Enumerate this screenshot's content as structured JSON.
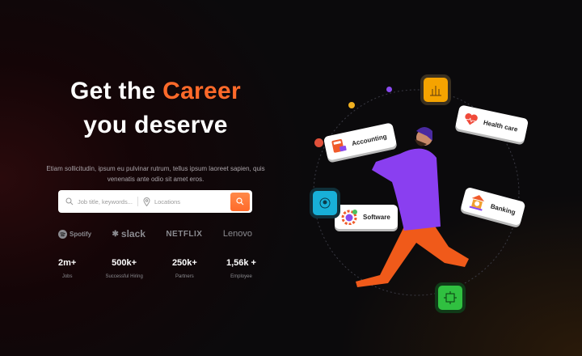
{
  "hero": {
    "title_pre": "Get the ",
    "title_accent": "Career",
    "title_line2": "you deserve",
    "description": "Etiam sollicitudin, ipsum eu pulvinar rutrum, tellus ipsum laoreet sapien, quis venenatis ante odio sit amet eros."
  },
  "search": {
    "job_placeholder": "Job title, keywords...",
    "location_placeholder": "Locations",
    "button_icon": "search-icon"
  },
  "logos": [
    "Spotify",
    "slack",
    "NETFLIX",
    "Lenovo"
  ],
  "stats": [
    {
      "value": "2m+",
      "label": "Jobs"
    },
    {
      "value": "500k+",
      "label": "Successful Hiring"
    },
    {
      "value": "250k+",
      "label": "Partners"
    },
    {
      "value": "1,56k +",
      "label": "Employee"
    }
  ],
  "categories": [
    "Accounting",
    "Health care",
    "Software",
    "Banking"
  ],
  "colors": {
    "accent": "#ff6a2a",
    "purple": "#7b3ff2"
  }
}
